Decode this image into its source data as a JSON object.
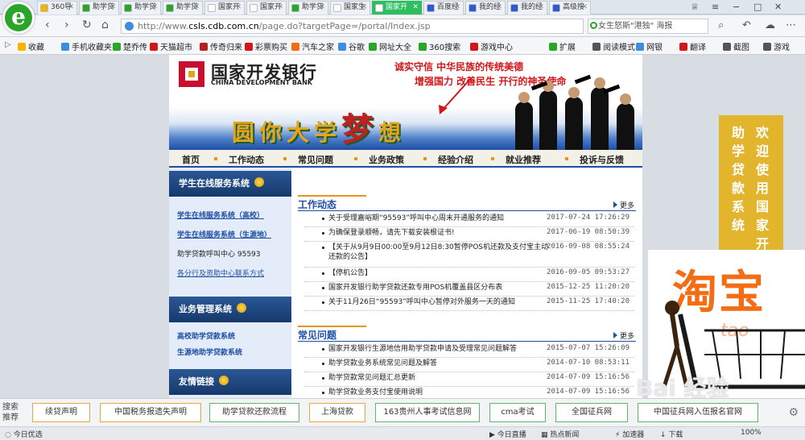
{
  "browser": {
    "tabs": [
      {
        "label": "360导",
        "icon_color": "#f5b400",
        "active": false
      },
      {
        "label": "助学贷",
        "icon_color": "#2aa52a",
        "active": false
      },
      {
        "label": "助学贷",
        "icon_color": "#2aa52a",
        "active": false
      },
      {
        "label": "助学贷",
        "icon_color": "#2aa52a",
        "active": false
      },
      {
        "label": "国家开",
        "icon_color": "#ffffff",
        "active": false
      },
      {
        "label": "国家开",
        "icon_color": "#ffffff",
        "active": false
      },
      {
        "label": "助学贷",
        "icon_color": "#2aa52a",
        "active": false
      },
      {
        "label": "国家生",
        "icon_color": "#ffffff",
        "active": false
      },
      {
        "label": "国家开",
        "icon_color": "#ffffff",
        "active": true
      },
      {
        "label": "百度经",
        "icon_color": "#2b5bd7",
        "active": false
      },
      {
        "label": "我的经",
        "icon_color": "#2b5bd7",
        "active": false
      },
      {
        "label": "我的经",
        "icon_color": "#2b5bd7",
        "active": false
      },
      {
        "label": "高级搜",
        "icon_color": "#2b5bd7",
        "active": false
      }
    ],
    "url_prefix": "http://www.",
    "url_domain": "csls.cdb.com.cn",
    "url_path": "/page.do?targetPage=/portal/Index.jsp",
    "search_text": "女生怒斯\"港独\" 海报",
    "bookmarks": [
      {
        "label": "收藏",
        "color": "#f5b400"
      },
      {
        "label": "手机收藏夹",
        "color": "#3d8ee0"
      },
      {
        "label": "楚乔传",
        "color": "#2aa52a"
      },
      {
        "label": "天猫超市",
        "color": "#d2171a"
      },
      {
        "label": "传奇归来",
        "color": "#b22222"
      },
      {
        "label": "彩票购买",
        "color": "#d2171a"
      },
      {
        "label": "汽车之家",
        "color": "#f26d13"
      },
      {
        "label": "谷歌",
        "color": "#3d8ee0"
      },
      {
        "label": "网址大全",
        "color": "#2aa52a"
      },
      {
        "label": "360搜索",
        "color": "#2aa52a"
      },
      {
        "label": "游戏中心",
        "color": "#d2171a"
      }
    ],
    "bm_right": [
      {
        "label": "扩展",
        "color": "#2aa52a"
      },
      {
        "label": "阅读模式",
        "color": "#555555"
      },
      {
        "label": "网银",
        "color": "#3d8ee0"
      },
      {
        "label": "翻译",
        "color": "#d2171a"
      },
      {
        "label": "截图",
        "color": "#555555"
      },
      {
        "label": "游戏",
        "color": "#555555"
      }
    ]
  },
  "site": {
    "logo_cn": "国家开发银行",
    "logo_en": "CHINA DEVELOPMENT BANK",
    "slogan1": "诚实守信  中华民族的传统美德",
    "slogan2": "增强国力  改善民生  开行的神圣使命",
    "dream_a": "圆你大学",
    "dream_b": "梦",
    "dream_c": "想",
    "nav": [
      "首页",
      "工作动态",
      "常见问题",
      "业务政策",
      "经验介绍",
      "就业推荐",
      "投诉与反馈"
    ],
    "left": {
      "sec1_title": "学生在线服务系统",
      "sec1_links": [
        "学生在线服务系统（高校）",
        "学生在线服务系统（生源地）"
      ],
      "hotline": "助学贷款呼叫中心 95593",
      "contact": "各分行及资助中心联系方式",
      "sec2_title": "业务管理系统",
      "sec2_links": [
        "高校助学贷款系统",
        "生源地助学贷款系统"
      ],
      "sec3_title": "友情链接"
    },
    "work": {
      "title": "工作动态",
      "more": "更多",
      "items": [
        {
          "text": "关于受理嘉峪期“95593”呼叫中心周末开通服务的通知",
          "date": "2017-07-24 17:26:29"
        },
        {
          "text": "为确保登录顺畅，请先下载安装根证书!",
          "date": "2017-06-19 08:50:39"
        },
        {
          "text": "【关于从9月9日00:00至9月12日8:30暂停POS机还款及支付宝主动还款的公告】",
          "date": "2016-09-08 08:55:24"
        },
        {
          "text": "【停机公告】",
          "date": "2016-09-05 09:53:27"
        },
        {
          "text": "国家开发银行助学贷款还款专用POS机覆盖县区分布表",
          "date": "2015-12-25 11:20:20"
        },
        {
          "text": "关于11月26日“95593”呼叫中心暂停对外服务一天的通知",
          "date": "2015-11-25 17:40:20"
        }
      ]
    },
    "faq": {
      "title": "常见问题",
      "more": "更多",
      "items": [
        {
          "text": "国家开发银行生源地信用助学贷款申请及受理常见问题解答",
          "date": "2015-07-07 15:26:09"
        },
        {
          "text": "助学贷款业务系统常见问题及解答",
          "date": "2014-07-10 08:53:11"
        },
        {
          "text": "助学贷款常见问题汇总更新",
          "date": "2014-07-09 15:16:56"
        },
        {
          "text": "助学贷款业务支付宝使用说明",
          "date": "2014-07-09 15:16:56"
        }
      ]
    },
    "side_banner": [
      "欢迎使用国家开",
      "助学贷款系统"
    ]
  },
  "ads": {
    "taobao": "淘宝",
    "taobao_small": "tao",
    "baidu": "Bai 经验"
  },
  "quickbar": {
    "label": "搜索推荐",
    "items": [
      {
        "label": "续贷声明",
        "green": false
      },
      {
        "label": "中国税务报遗失声明",
        "green": false
      },
      {
        "label": "助学贷款还款流程",
        "green": true
      },
      {
        "label": "上海贷款",
        "green": false
      },
      {
        "label": "163贵州人事考试信息网",
        "green": true
      },
      {
        "label": "cma考试",
        "green": true
      },
      {
        "label": "全国征兵网",
        "green": true
      },
      {
        "label": "中国征兵网入伍报名官网",
        "green": true
      }
    ]
  },
  "statusbar": {
    "left": "今日优选",
    "items": [
      "今日直播",
      "热点新闻",
      "加速器",
      "下载"
    ],
    "zoom": "100%"
  }
}
